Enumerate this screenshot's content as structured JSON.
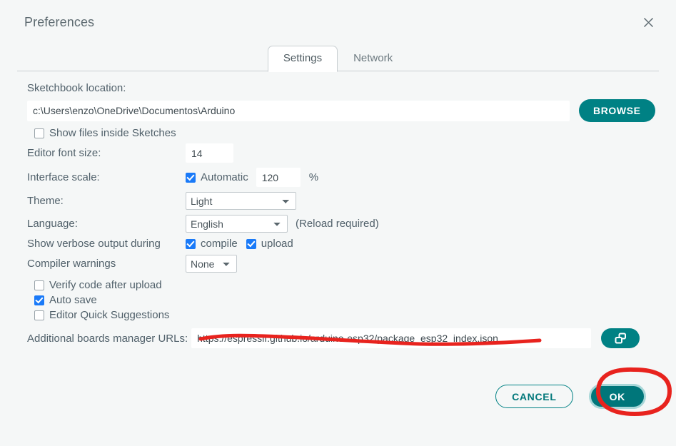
{
  "window": {
    "title": "Preferences",
    "close_icon": "close-icon"
  },
  "tabs": [
    {
      "label": "Settings",
      "active": true
    },
    {
      "label": "Network",
      "active": false
    }
  ],
  "settings": {
    "sketchbook": {
      "label": "Sketchbook location:",
      "value": "c:\\Users\\enzo\\OneDrive\\Documentos\\Arduino",
      "browse_label": "BROWSE"
    },
    "show_files_inside_sketches": {
      "label": "Show files inside Sketches",
      "checked": false
    },
    "editor_font_size": {
      "label": "Editor font size:",
      "value": "14"
    },
    "interface_scale": {
      "label": "Interface scale:",
      "automatic_label": "Automatic",
      "automatic_checked": true,
      "value": "120",
      "unit": "%"
    },
    "theme": {
      "label": "Theme:",
      "value": "Light",
      "options": [
        "Light"
      ]
    },
    "language": {
      "label": "Language:",
      "value": "English",
      "options": [
        "English"
      ],
      "note": "(Reload required)"
    },
    "verbose_output": {
      "label": "Show verbose output during",
      "compile_label": "compile",
      "compile_checked": true,
      "upload_label": "upload",
      "upload_checked": true
    },
    "compiler_warnings": {
      "label": "Compiler warnings",
      "value": "None",
      "options": [
        "None"
      ]
    },
    "verify_code_after_upload": {
      "label": "Verify code after upload",
      "checked": false
    },
    "auto_save": {
      "label": "Auto save",
      "checked": true
    },
    "editor_quick_suggestions": {
      "label": "Editor Quick Suggestions",
      "checked": false
    },
    "additional_urls": {
      "label": "Additional boards manager URLs:",
      "value": "https://espressif.github.io/arduino-esp32/package_esp32_index.json",
      "expand_icon": "multi-window-icon"
    }
  },
  "footer": {
    "cancel_label": "CANCEL",
    "ok_label": "OK"
  },
  "colors": {
    "accent_teal": "#008184",
    "ok_teal": "#00767a",
    "checkbox_blue": "#1a7af8",
    "annotation_red": "#e8231e",
    "background": "#f5f7f7",
    "text": "#50606a"
  },
  "annotations": [
    {
      "name": "red-underline-urls",
      "shape": "wavy-line",
      "color": "#e8231e"
    },
    {
      "name": "red-circle-ok",
      "shape": "ellipse",
      "color": "#e8231e"
    }
  ]
}
